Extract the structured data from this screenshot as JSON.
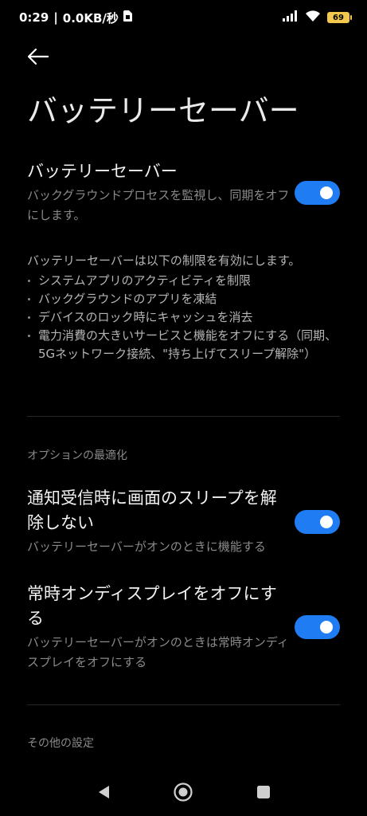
{
  "status_bar": {
    "time": "0:29",
    "network_speed": "0.0KB/秒",
    "battery_level": "69",
    "icons": [
      "sim-icon",
      "signal-icon",
      "wifi-icon",
      "battery-icon"
    ]
  },
  "header": {
    "title": "バッテリーセーバー"
  },
  "main_setting": {
    "title": "バッテリーセーバー",
    "description": "バックグラウンドプロセスを監視し、同期をオフにします。",
    "enabled": true
  },
  "info": {
    "intro": "バッテリーセーバーは以下の制限を有効にします。",
    "items": [
      "システムアプリのアクティビティを制限",
      "バックグラウンドのアプリを凍結",
      "デバイスのロック時にキャッシュを消去",
      "電力消費の大きいサービスと機能をオフにする（同期、5Gネットワーク接続、\"持ち上げてスリープ解除\"）"
    ]
  },
  "sections": {
    "optimization_header": "オプションの最適化",
    "other_header": "その他の設定"
  },
  "options": [
    {
      "title": "通知受信時に画面のスリープを解除しない",
      "description": "バッテリーセーバーがオンのときに機能する",
      "enabled": true
    },
    {
      "title": "常時オンディスプレイをオフにする",
      "description": "バッテリーセーバーがオンのときは常時オンディスプレイをオフにする",
      "enabled": true
    }
  ],
  "colors": {
    "accent": "#1f7cf3",
    "background": "#000000",
    "secondary_text": "#8a8a8a"
  }
}
